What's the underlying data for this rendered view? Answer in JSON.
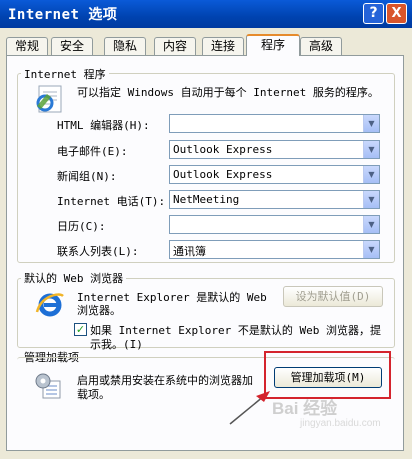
{
  "window": {
    "title": "Internet 选项",
    "help_button": "?",
    "close_button": "X"
  },
  "tabs": [
    "常规",
    "安全",
    "隐私",
    "内容",
    "连接",
    "程序",
    "高级"
  ],
  "active_tab": "程序",
  "internet_programs": {
    "legend": "Internet 程序",
    "description": "可以指定 Windows 自动用于每个 Internet 服务的程序。",
    "rows": [
      {
        "label": "HTML 编辑器(H):",
        "value": ""
      },
      {
        "label": "电子邮件(E):",
        "value": "Outlook Express"
      },
      {
        "label": "新闻组(N):",
        "value": "Outlook Express"
      },
      {
        "label": "Internet 电话(T):",
        "value": "NetMeeting"
      },
      {
        "label": "日历(C):",
        "value": ""
      },
      {
        "label": "联系人列表(L):",
        "value": "通讯簿"
      }
    ]
  },
  "default_browser": {
    "legend": "默认的 Web 浏览器",
    "line1": "Internet Explorer 是默认的 Web",
    "line2": "浏览器。",
    "set_default_button": "设为默认值(D)",
    "check_line1": "如果 Internet Explorer 不是默认的 Web 浏览器，提",
    "check_line2": "示我。(I)",
    "checked": true
  },
  "addons": {
    "legend": "管理加载项",
    "line1": "启用或禁用安装在系统中的浏览器加",
    "line2": "载项。",
    "manage_button": "管理加载项(M)"
  },
  "watermark": {
    "text": "Bai 经验",
    "sub": "jingyan.baidu.com"
  },
  "colors": {
    "highlight_box": "#d4242d",
    "titlebar": "#0a5ad8"
  }
}
